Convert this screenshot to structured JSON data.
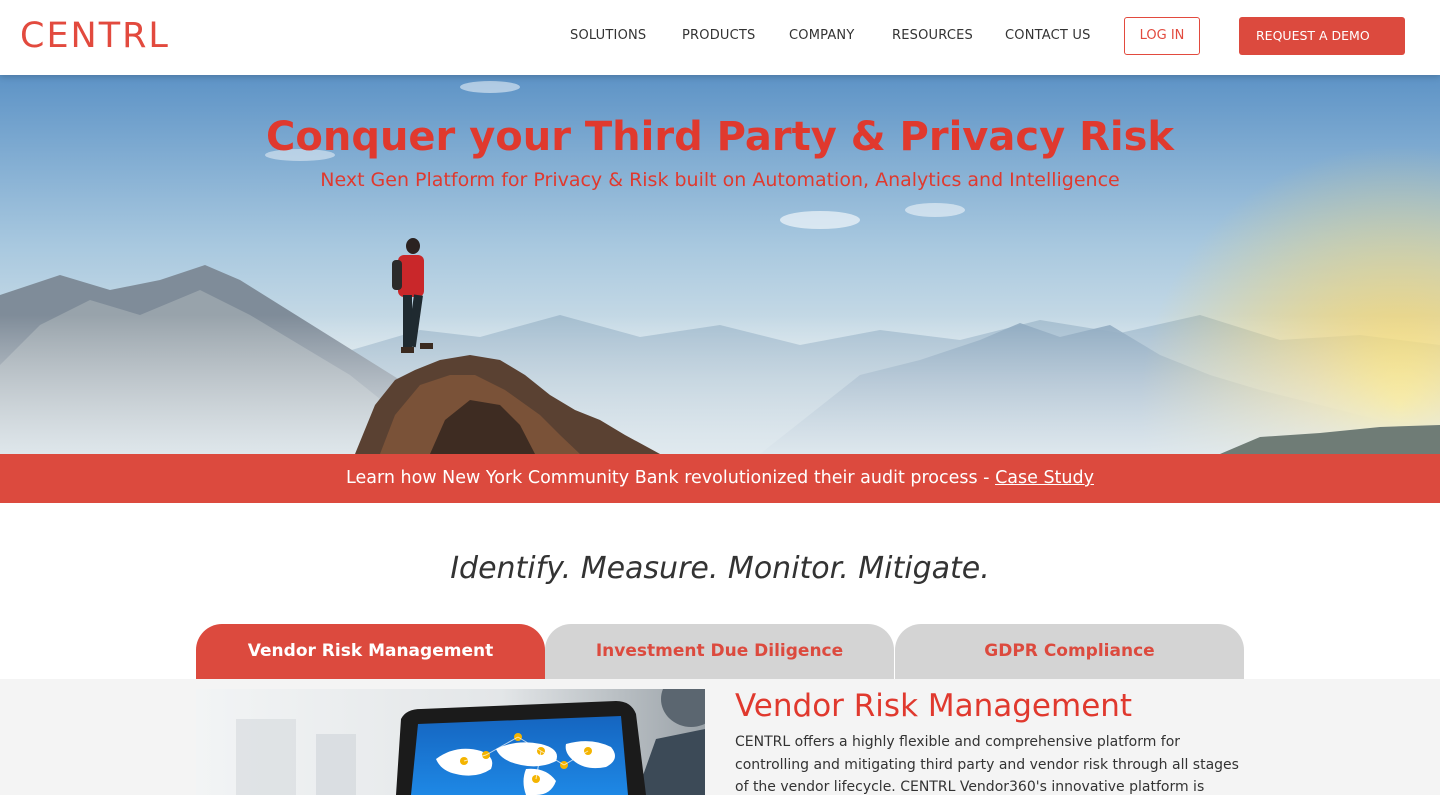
{
  "brand": {
    "logo": "CENTRL",
    "accent": "#dc4a3e"
  },
  "nav": {
    "items": [
      "SOLUTIONS",
      "PRODUCTS",
      "COMPANY",
      "RESOURCES",
      "CONTACT US"
    ],
    "login": "LOG IN",
    "demo": "REQUEST A DEMO"
  },
  "hero": {
    "title": "Conquer your Third Party & Privacy Risk",
    "subtitle": "Next Gen Platform for Privacy & Risk built on Automation, Analytics and Intelligence"
  },
  "banner": {
    "text": "Learn how New York Community Bank revolutionized their audit process - ",
    "link": "Case Study"
  },
  "tagline": "Identify. Measure. Monitor. Mitigate.",
  "tabs": [
    "Vendor Risk Management",
    "Investment Due Diligence",
    "GDPR Compliance"
  ],
  "panel": {
    "title": "Vendor Risk Management",
    "text": "CENTRL offers a highly flexible and comprehensive platform for controlling and mitigating third party and vendor risk through all stages of the vendor lifecycle. CENTRL Vendor360's innovative platform is shared between vendors"
  }
}
